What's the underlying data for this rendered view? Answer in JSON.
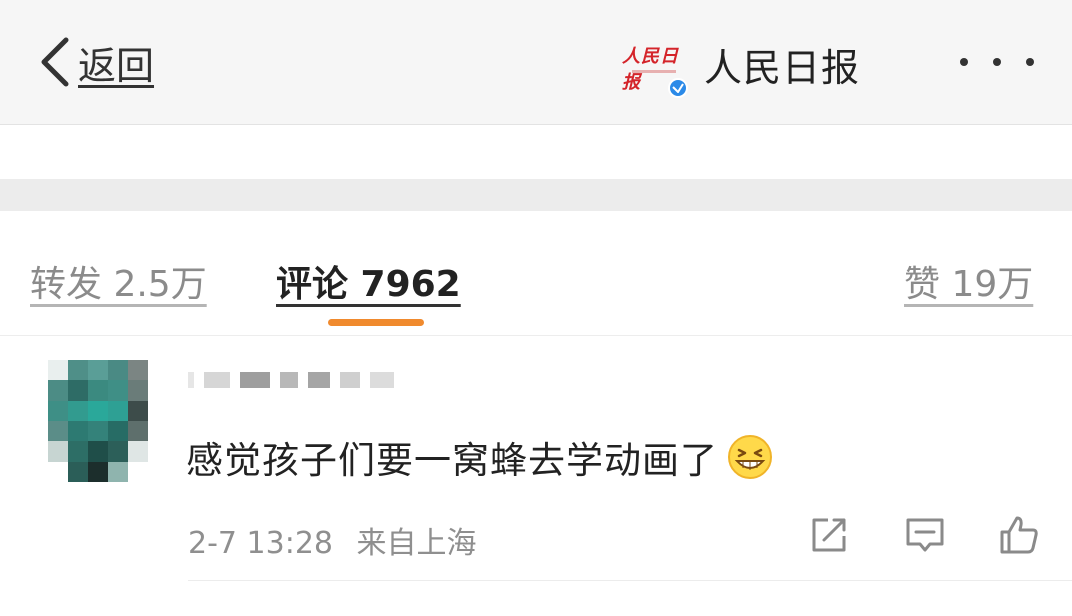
{
  "nav": {
    "back_label": "返回",
    "account_name": "人民日报",
    "logo_text": "人民日报"
  },
  "tabs": {
    "repost": "转发 2.5万",
    "comment": "评论 7962",
    "like": "赞 19万",
    "active": "comment"
  },
  "comment": {
    "text": "感觉孩子们要一窝蜂去学动画了",
    "emoji": "grinning-face-emoji",
    "time": "2-7 13:28",
    "source": "来自上海"
  },
  "colors": {
    "accent_indicator": "#f08a2e",
    "verified_badge": "#2b8ae8",
    "logo_red": "#d4242a"
  },
  "icons": [
    "chevron-left-icon",
    "verified-icon",
    "more-dots-icon",
    "repost-icon",
    "comment-icon",
    "like-icon"
  ]
}
